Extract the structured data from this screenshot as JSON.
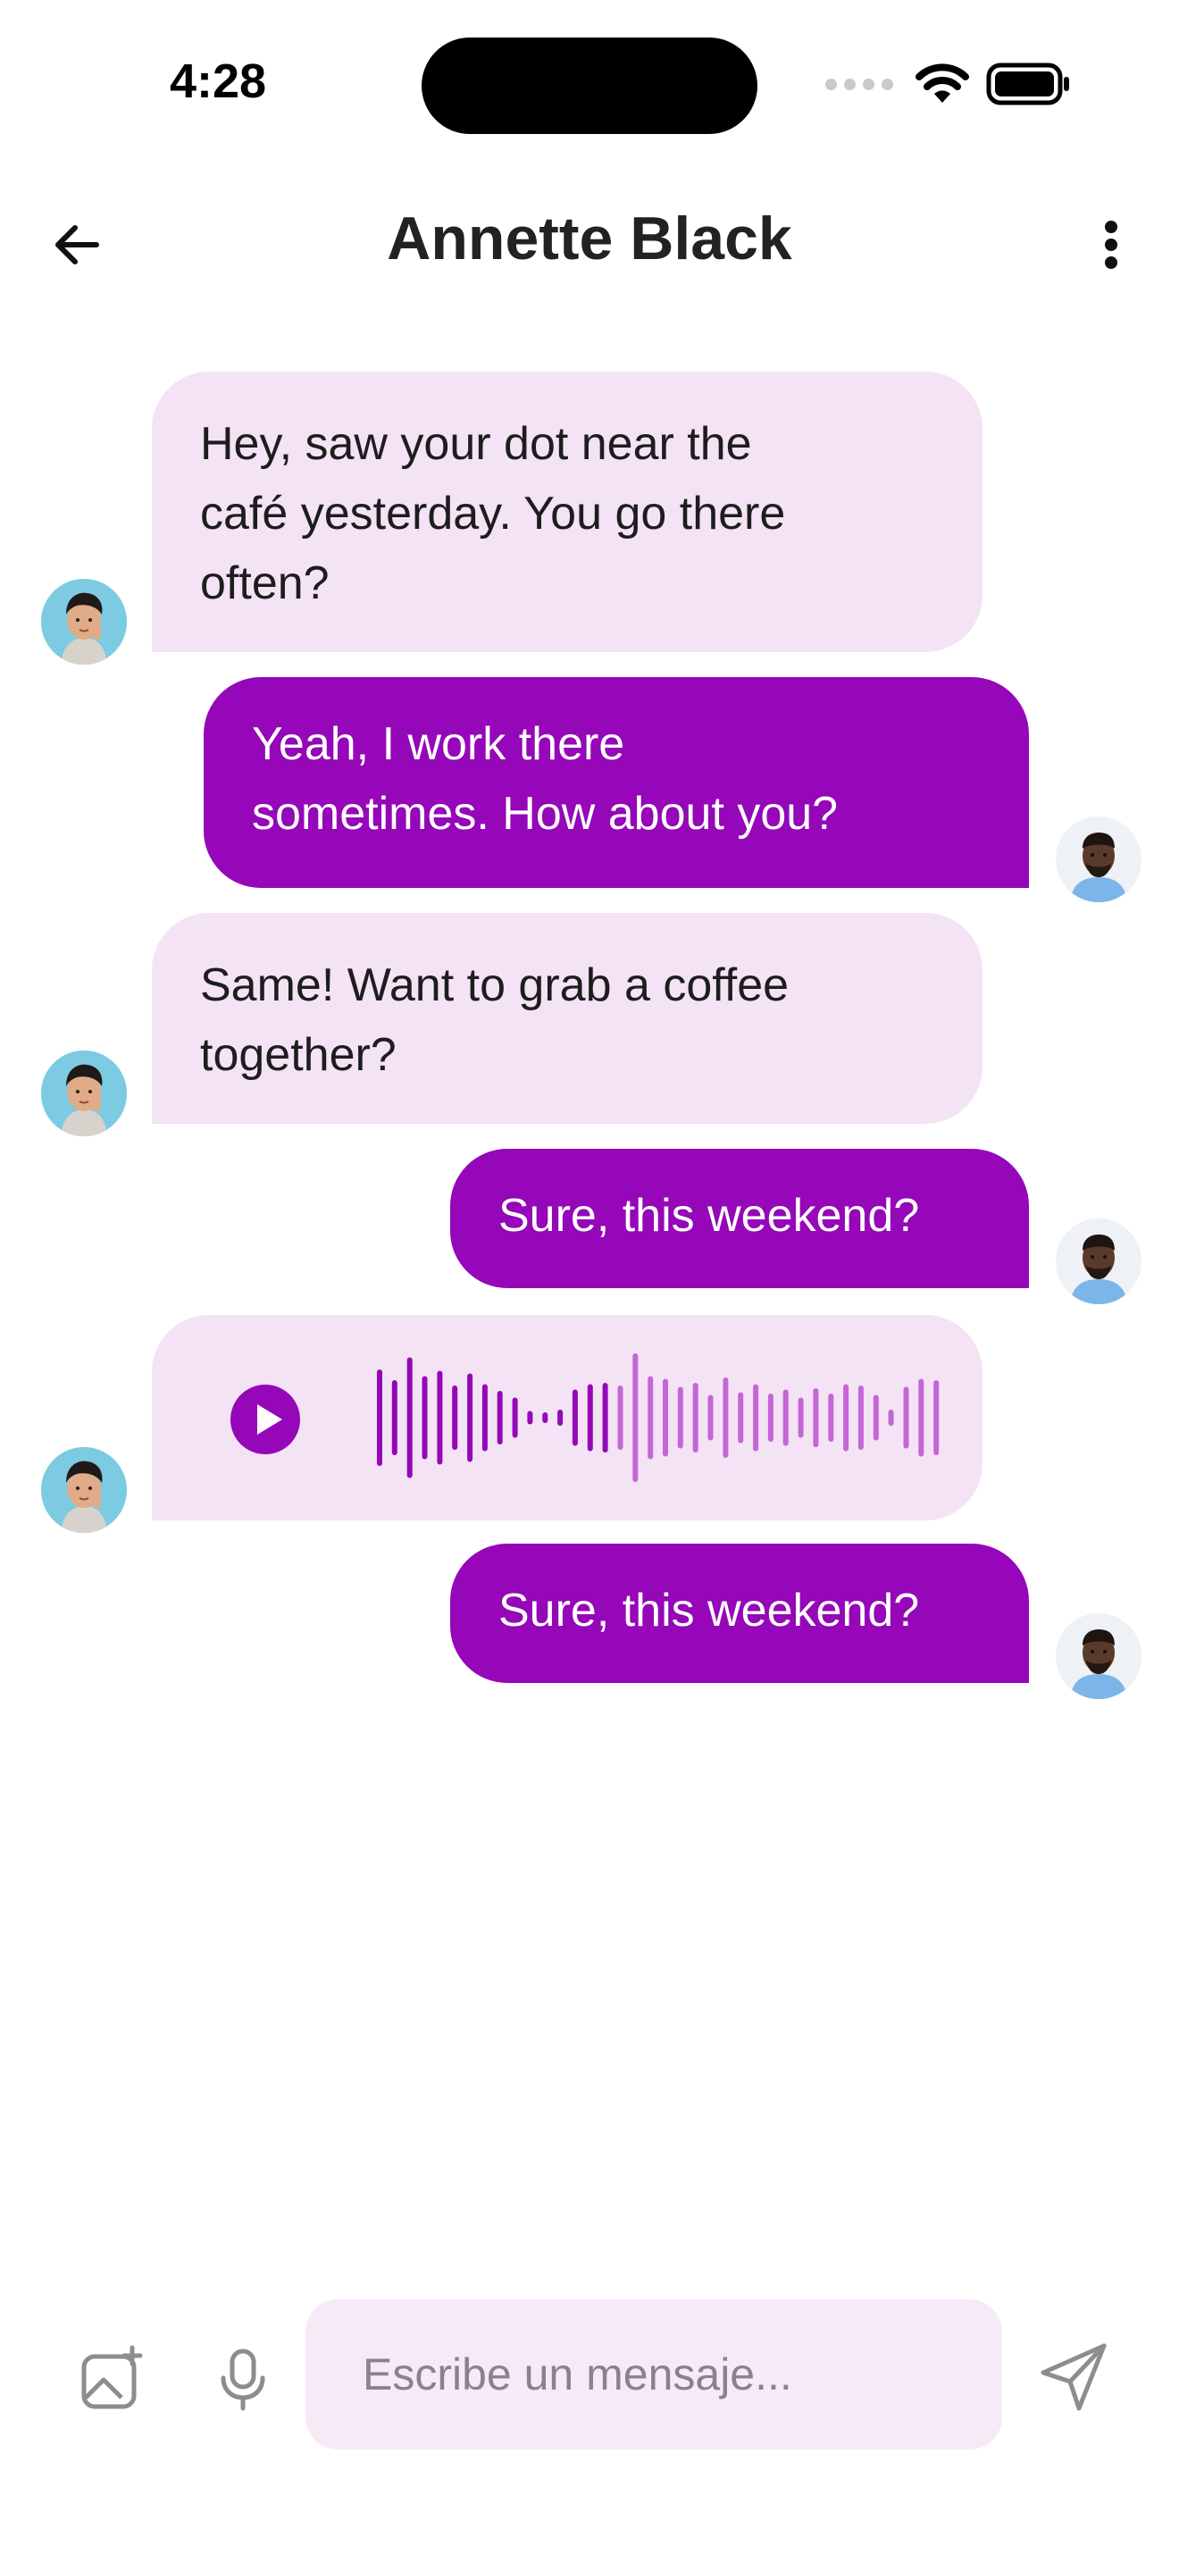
{
  "status_bar": {
    "time": "4:28"
  },
  "header": {
    "contact_name": "Annette Black"
  },
  "messages": [
    {
      "direction": "incoming",
      "text": "Hey, saw your dot near the\ncafé yesterday. You go there\noften?"
    },
    {
      "direction": "outgoing",
      "text": "Yeah, I work there\nsometimes. How about you?"
    },
    {
      "direction": "incoming",
      "text": "Same! Want to grab a coffee\ntogether?"
    },
    {
      "direction": "outgoing",
      "text": "Sure, this weekend?"
    },
    {
      "direction": "incoming",
      "type": "voice",
      "played_fraction": 0.4
    },
    {
      "direction": "outgoing",
      "text": "Sure, this weekend?"
    }
  ],
  "composer": {
    "placeholder": "Escribe un mensaje..."
  },
  "icons": {
    "back": "arrow-left-icon",
    "more": "more-vertical-icon",
    "attach": "image-plus-icon",
    "mic": "microphone-icon",
    "send": "send-icon",
    "play": "play-icon"
  },
  "colors": {
    "accent": "#9507b8",
    "incoming_bubble": "#f3e3f4",
    "input_background": "#f6eaf7",
    "waveform_played": "#9507b8",
    "waveform_unplayed": "#c466d6"
  }
}
